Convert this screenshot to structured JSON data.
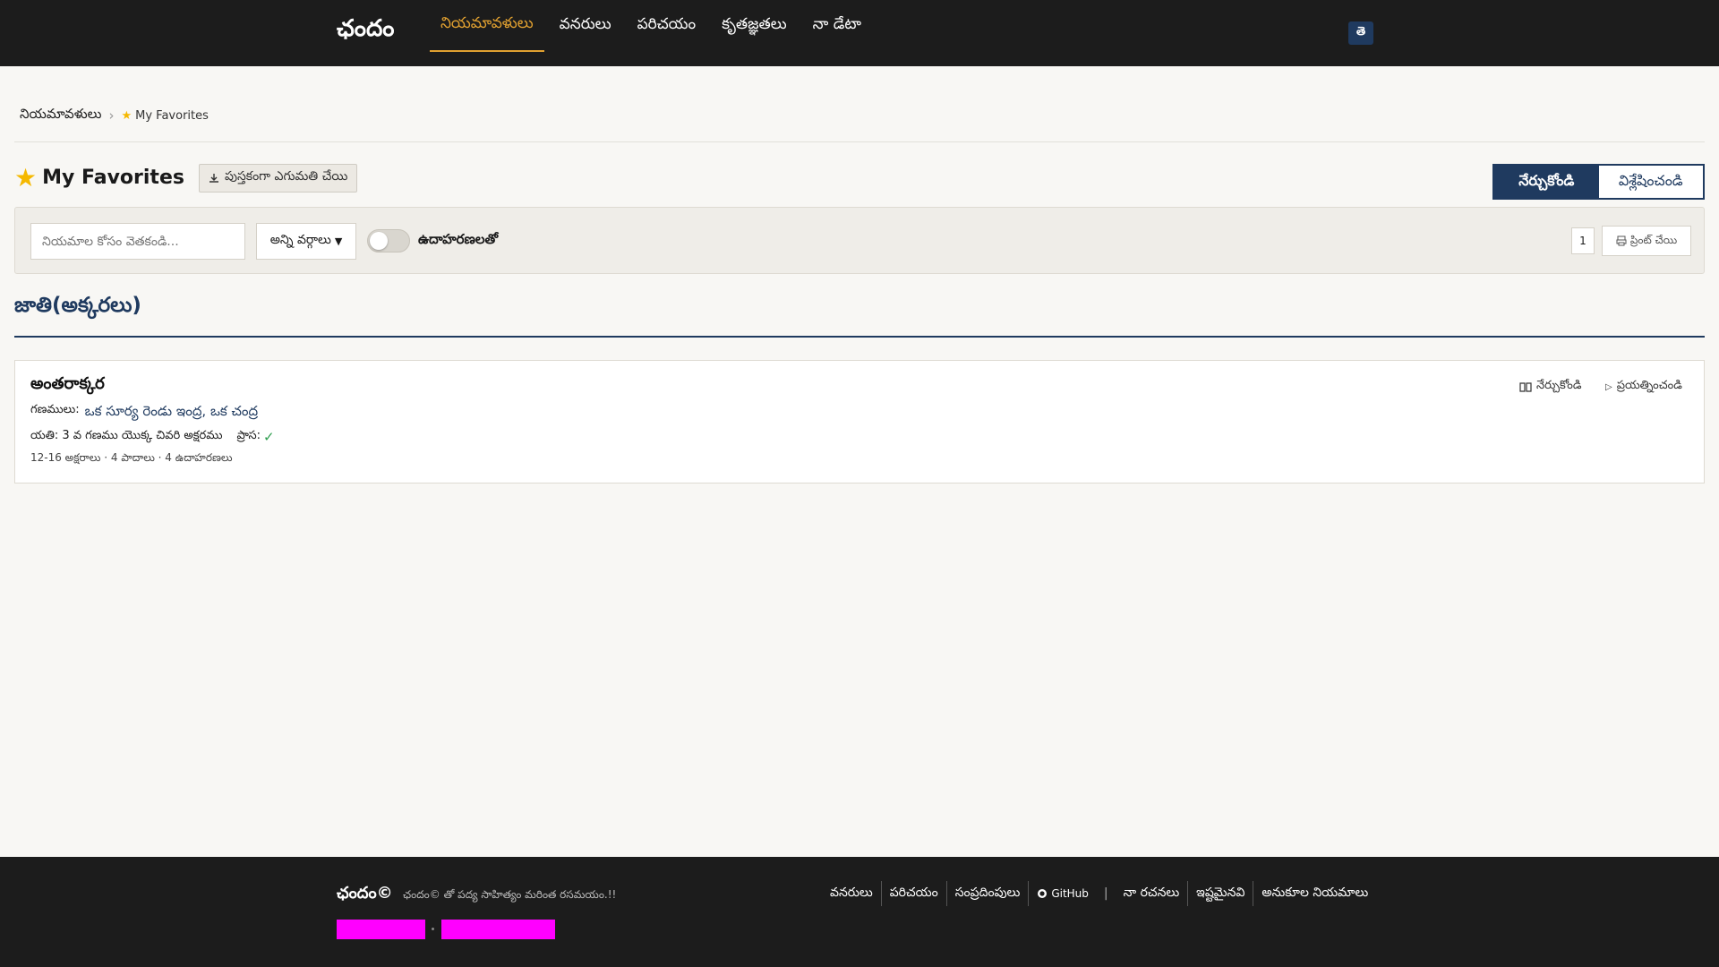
{
  "header": {
    "brand": "ఛందం",
    "nav": [
      "నియమావళులు",
      "వనరులు",
      "పరిచయం",
      "కృతజ్ఞతలు",
      "నా డేటా"
    ],
    "lang_button": "తె"
  },
  "breadcrumb": {
    "root": "నియమావళులు",
    "current": "My Favorites"
  },
  "title": {
    "text": "My Favorites",
    "download": "పుస్తకంగా ఎగుమతి చేయి"
  },
  "mode": {
    "learn": "నేర్చుకోండి",
    "analyze": "విశ్లేషించండి"
  },
  "filters": {
    "search_placeholder": "నియమాల కోసం వెతకండి...",
    "category": "అన్ని వర్గాలు",
    "toggle_label": "ఉదాహరణలతో",
    "page_count": "1",
    "print": "ప్రింట్ చేయి"
  },
  "section": {
    "title": "జాతి(అక్కరలు)"
  },
  "rule": {
    "name": "అంతరాక్కర",
    "gana_label": "గణములు:",
    "gana_value": "ఒక సూర్య రెండు ఇంద్ర, ఒక చంద్ర",
    "yati": "యతి: 3 వ గణము యొక్క చివరి అక్షరము",
    "prasa": "ప్రాస:",
    "meta": "12-16 అక్షరాలు · 4 పాదాలు · 4 ఉదాహరణలు",
    "learn": "నేర్చుకోండి",
    "try": "ప్రయత్నించండి"
  },
  "footer": {
    "brand": "ఛందం©",
    "tagline": "ఛందం© తో పద్య సాహిత్యం మరింత రసమయం.!!",
    "links": [
      "వనరులు",
      "పరిచయం",
      "సంప్రదింపులు",
      "GitHub"
    ],
    "links2": [
      "నా రచనలు",
      "ఇష్టమైనవి",
      "అనుకూల నియమాలు"
    ],
    "separator": "|"
  },
  "colors": {
    "primary": "#1f3a5f",
    "accent": "#e0a030",
    "header_bg": "#1c1c1c",
    "highlight": "#ff00ff"
  }
}
